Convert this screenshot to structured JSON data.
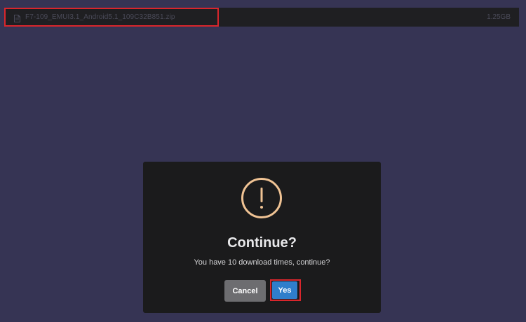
{
  "file_bar": {
    "file_name": "F7-109_EMUI3.1_Android5.1_109C32B851.zip",
    "file_size": "1.25GB",
    "icon": "file-icon"
  },
  "dialog": {
    "icon": "warning-exclamation-icon",
    "title": "Continue?",
    "message": "You have 10 download times, continue?",
    "cancel_label": "Cancel",
    "confirm_label": "Yes"
  },
  "colors": {
    "background": "#363454",
    "bar": "#1f1f22",
    "modal": "#1b1b1c",
    "warning": "#f0c394",
    "cancel": "#6d6d70",
    "confirm": "#2f7ecb",
    "highlight": "#d9262c"
  }
}
